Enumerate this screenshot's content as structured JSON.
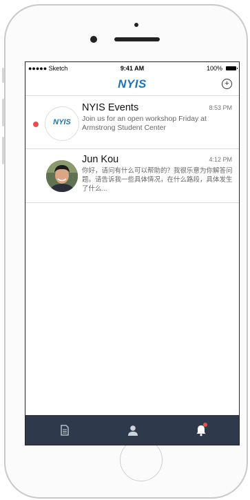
{
  "status_bar": {
    "carrier": "●●●●● Sketch",
    "time": "9:41 AM",
    "battery": "100%"
  },
  "navbar": {
    "logo": "NYIS",
    "compose_glyph": "+"
  },
  "messages": [
    {
      "name": "NYIS Events",
      "time": "8:53 PM",
      "avatar_text": "NYIS",
      "unread": true,
      "body": "Join us for an open workshop Friday at Armstrong Student Center"
    },
    {
      "name": "Jun Kou",
      "time": "4:12 PM",
      "unread": false,
      "body": "你好，请问有什么可以帮助的？我很乐意为你解答问题。请告诉我一些具体情况，在什么路段，具体发生了什么..."
    }
  ],
  "tabbar": {
    "tabs": [
      "document-icon",
      "user-icon",
      "bell-icon"
    ],
    "bell_badge": true
  },
  "colors": {
    "brand": "#1e72b8",
    "unread": "#e8514f",
    "tabbar": "#2e3a4c"
  }
}
